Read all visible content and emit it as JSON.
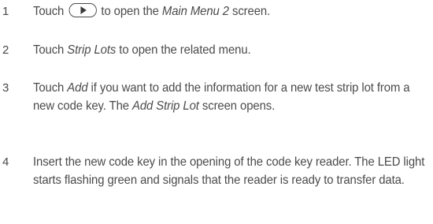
{
  "steps": [
    {
      "number": "1",
      "parts": {
        "a": "Touch",
        "b": "to open the",
        "c": "Main Menu 2",
        "d": "screen."
      }
    },
    {
      "number": "2",
      "parts": {
        "a": "Touch",
        "b": "Strip Lots",
        "c": "to open the related menu."
      }
    },
    {
      "number": "3",
      "parts": {
        "a": "Touch",
        "b": "Add",
        "c": "if you want to add the information for a new test strip lot from a new code key. The",
        "d": "Add Strip Lot",
        "e": "screen opens."
      }
    },
    {
      "number": "4",
      "parts": {
        "a": "Insert the new code key in the opening of the code key reader. The LED light starts flashing green and signals that the reader is ready to transfer data."
      }
    }
  ],
  "icons": {
    "forward_button": "play-triangle-in-rounded-button"
  }
}
